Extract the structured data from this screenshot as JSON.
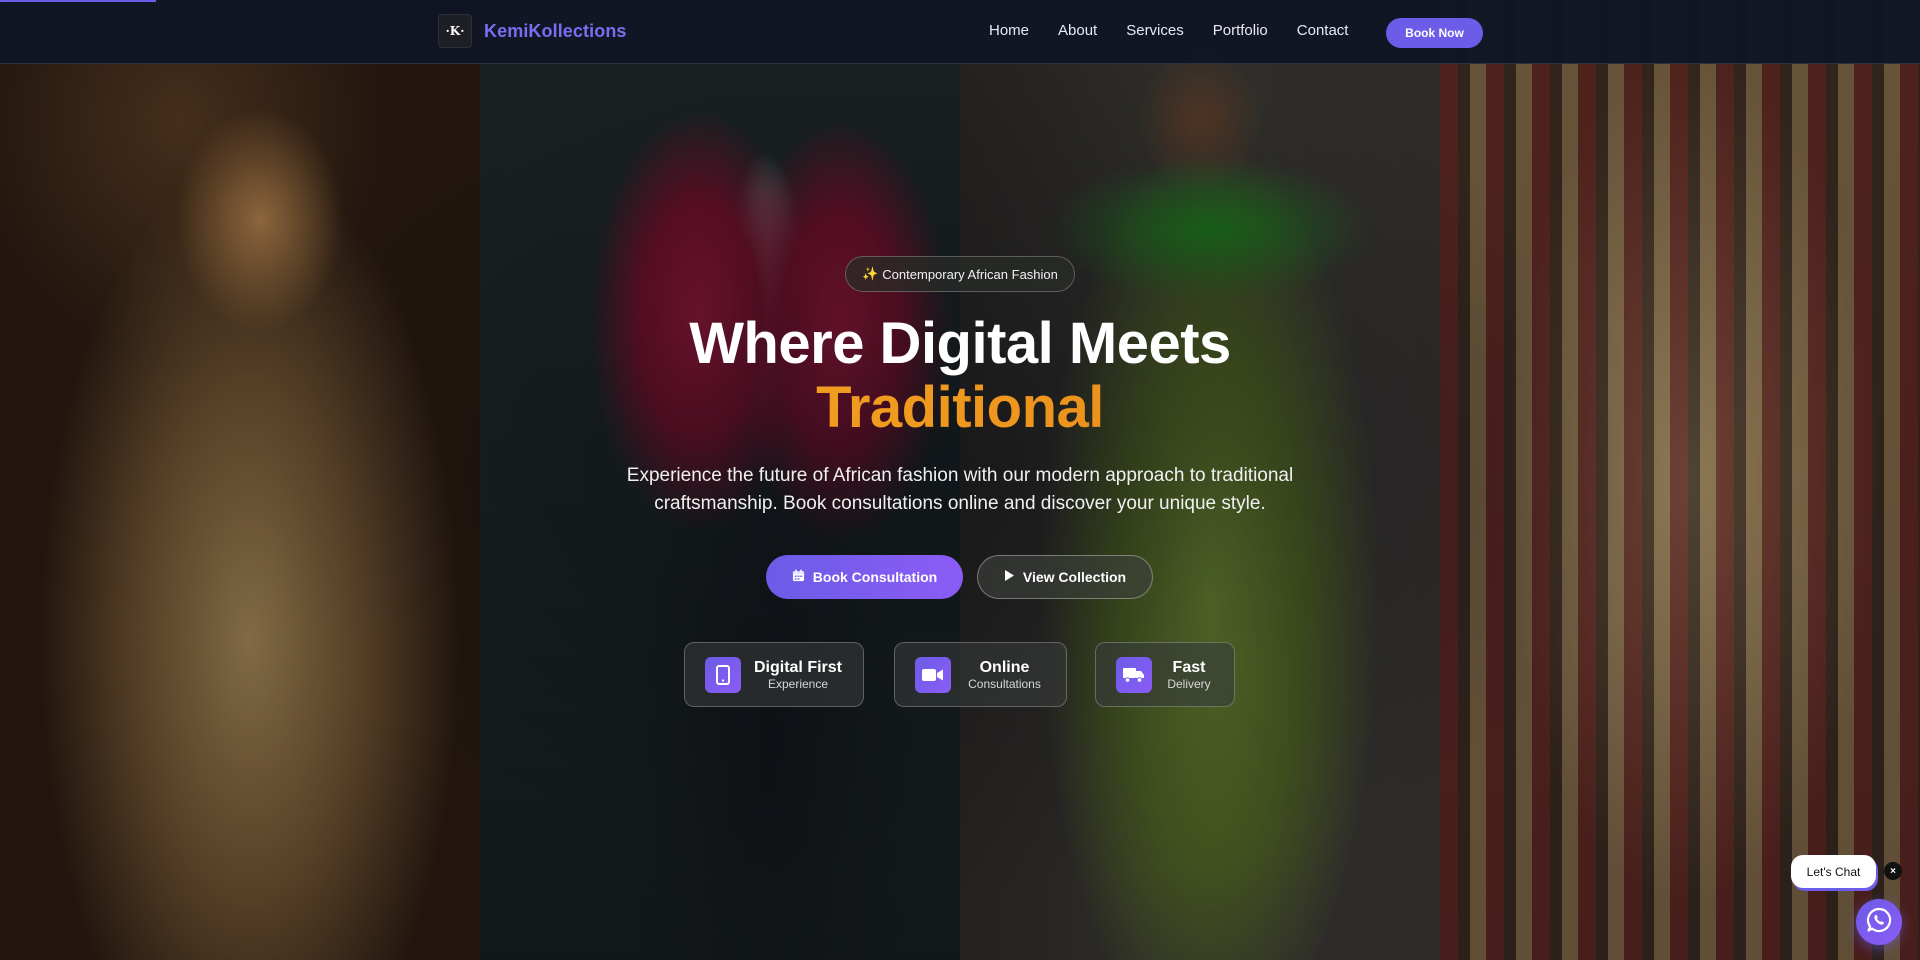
{
  "brand": {
    "logo_text": "K",
    "name": "KemiKollections"
  },
  "nav": {
    "links": [
      "Home",
      "About",
      "Services",
      "Portfolio",
      "Contact"
    ],
    "cta_label": "Book Now"
  },
  "hero": {
    "badge_icon": "sparkles-icon",
    "badge_text": "Contemporary African Fashion",
    "title_line1": "Where Digital Meets",
    "title_line2": "Traditional",
    "subtitle": "Experience the future of African fashion with our modern approach to traditional craftsmanship. Book consultations online and discover your unique style.",
    "primary_button": {
      "icon": "calendar-icon",
      "label": "Book Consultation"
    },
    "secondary_button": {
      "icon": "play-icon",
      "label": "View Collection"
    },
    "features": [
      {
        "icon": "mobile-phone-icon",
        "title": "Digital First",
        "subtitle": "Experience"
      },
      {
        "icon": "video-camera-icon",
        "title": "Online",
        "subtitle": "Consultations"
      },
      {
        "icon": "truck-icon",
        "title": "Fast",
        "subtitle": "Delivery"
      }
    ]
  },
  "chat": {
    "bubble_label": "Let's Chat",
    "close_symbol": "×",
    "fab_icon": "whatsapp-icon"
  },
  "colors": {
    "accent": "#6c5ce7",
    "accent_secondary": "#8b5cf6",
    "title_highlight": "#f5a623",
    "navbar_bg": "#111624"
  }
}
